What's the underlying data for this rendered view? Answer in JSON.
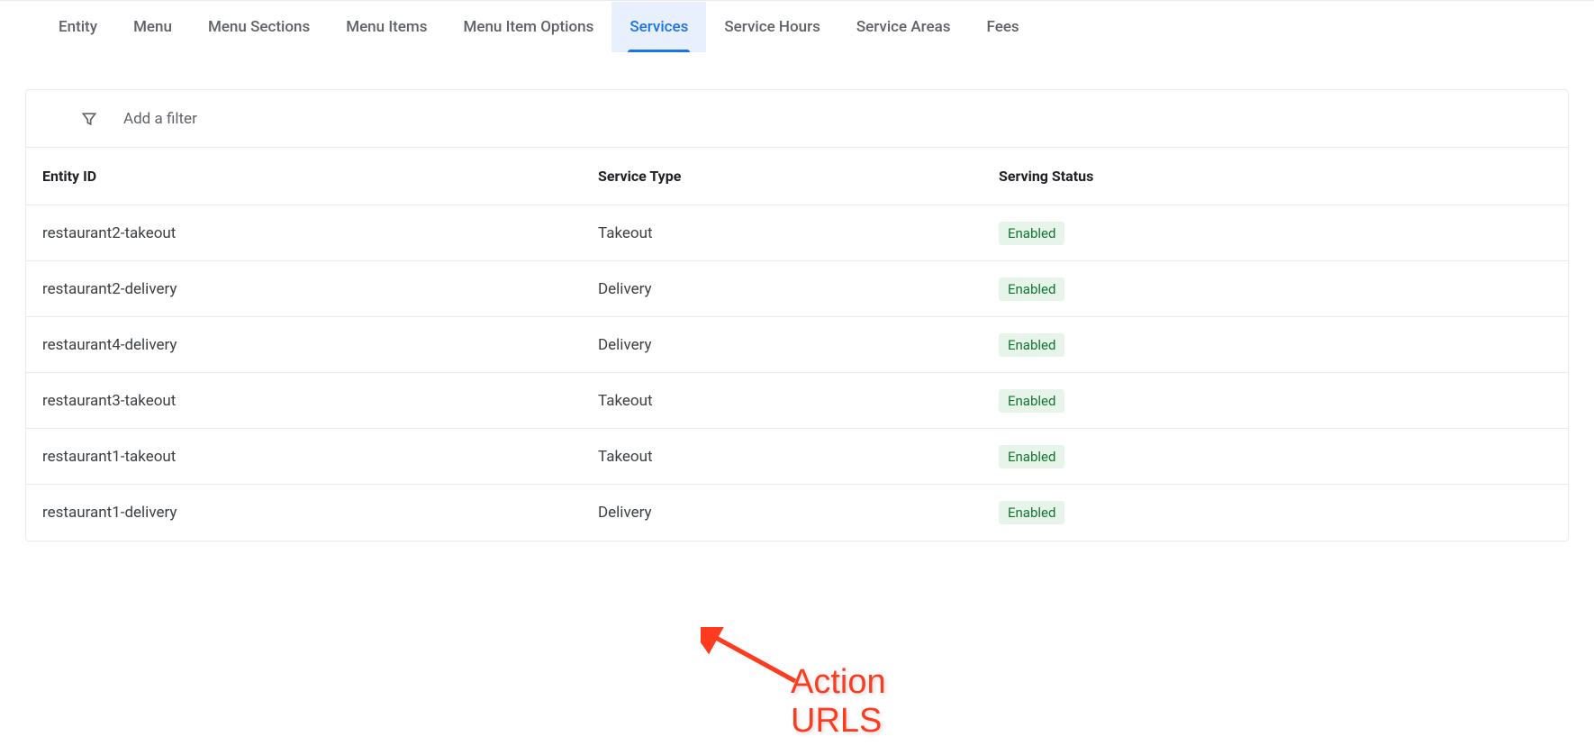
{
  "tabs": [
    {
      "label": "Entity",
      "active": false
    },
    {
      "label": "Menu",
      "active": false
    },
    {
      "label": "Menu Sections",
      "active": false
    },
    {
      "label": "Menu Items",
      "active": false
    },
    {
      "label": "Menu Item Options",
      "active": false
    },
    {
      "label": "Services",
      "active": true
    },
    {
      "label": "Service Hours",
      "active": false
    },
    {
      "label": "Service Areas",
      "active": false
    },
    {
      "label": "Fees",
      "active": false
    }
  ],
  "filter": {
    "placeholder": "Add a filter"
  },
  "table": {
    "headers": {
      "entity_id": "Entity ID",
      "service_type": "Service Type",
      "serving_status": "Serving Status"
    },
    "rows": [
      {
        "entity_id": "restaurant2-takeout",
        "service_type": "Takeout",
        "serving_status": "Enabled"
      },
      {
        "entity_id": "restaurant2-delivery",
        "service_type": "Delivery",
        "serving_status": "Enabled"
      },
      {
        "entity_id": "restaurant4-delivery",
        "service_type": "Delivery",
        "serving_status": "Enabled"
      },
      {
        "entity_id": "restaurant3-takeout",
        "service_type": "Takeout",
        "serving_status": "Enabled"
      },
      {
        "entity_id": "restaurant1-takeout",
        "service_type": "Takeout",
        "serving_status": "Enabled"
      },
      {
        "entity_id": "restaurant1-delivery",
        "service_type": "Delivery",
        "serving_status": "Enabled"
      }
    ]
  },
  "annotation": {
    "text": "Action URLS"
  }
}
